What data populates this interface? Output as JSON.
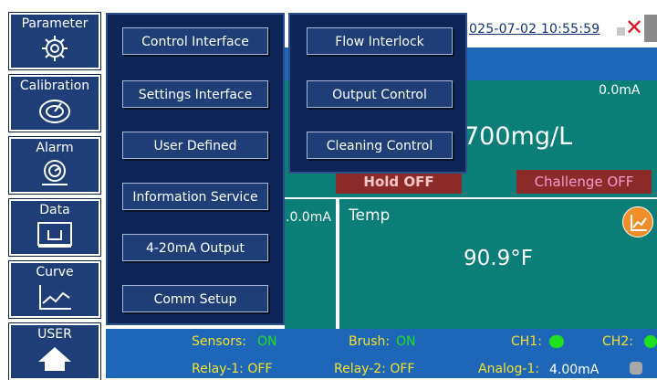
{
  "header": {
    "datetime": "025-07-02 10:55:59"
  },
  "rail": {
    "items": [
      {
        "label": "Parameter",
        "icon": "gear-icon"
      },
      {
        "label": "Calibration",
        "icon": "calibration-icon"
      },
      {
        "label": "Alarm",
        "icon": "alarm-icon"
      },
      {
        "label": "Data",
        "icon": "data-icon"
      },
      {
        "label": "Curve",
        "icon": "curve-icon"
      },
      {
        "label": "USER",
        "icon": "home-icon"
      }
    ]
  },
  "menu_primary": {
    "items": [
      "Control Interface",
      "Settings Interface",
      "User Defined",
      "Information Service",
      "4-20mA Output",
      "Comm Setup"
    ]
  },
  "menu_secondary": {
    "items": [
      "Flow Interlock",
      "Output Control",
      "Cleaning Control"
    ]
  },
  "main": {
    "top_ma": "0.0mA",
    "main_value": "700mg/L",
    "left_ma": ".0.0mA",
    "hold": "Hold OFF",
    "challenge": "Challenge OFF",
    "temp_label": "Temp",
    "temp_value": "90.9°F"
  },
  "status_bar": {
    "sensors_label": "Sensors:",
    "sensors_value": "ON",
    "brush_label": "Brush:",
    "brush_value": "ON",
    "ch1_label": "CH1:",
    "ch2_label": "CH2:",
    "relay1": "Relay-1: OFF",
    "relay2": "Relay-2: OFF",
    "analog1_label": "Analog-1:",
    "analog1_value": "4.00mA"
  },
  "colors": {
    "rail_bg": "#1f3e78",
    "menu_bg": "#0e2657",
    "teal": "#0b7f77",
    "status_blue": "#1e67b8",
    "on_green": "#1fe01f",
    "status_yellow": "#f5e12a"
  }
}
